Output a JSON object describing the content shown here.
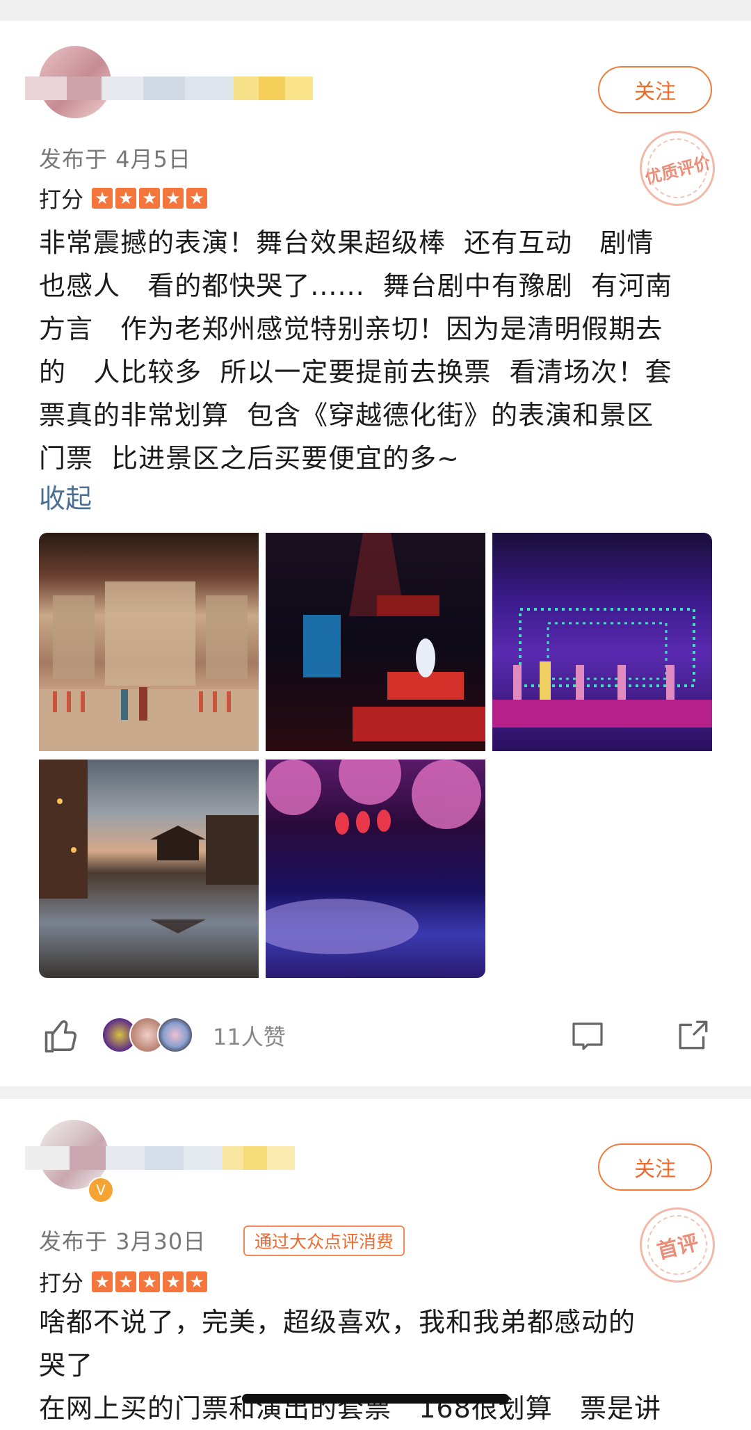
{
  "reviews": [
    {
      "follow_label": "关注",
      "stamp": "优质评价",
      "date": "发布于 4月5日",
      "score_label": "打分",
      "stars": 5,
      "text": "非常震撼的表演！舞台效果超级棒  还有互动   剧情\n也感人   看的都快哭了......  舞台剧中有豫剧  有河南\n方言   作为老郑州感觉特别亲切！因为是清明假期去\n的   人比较多  所以一定要提前去换票  看清场次！套\n票真的非常划算  包含《穿越德化街》的表演和景区\n门票  比进景区之后买要便宜的多~",
      "collapse_label": "收起",
      "photos": [
        "stage-street-scene",
        "stage-opera-red",
        "stage-purple-dance",
        "night-pavilion-reflection",
        "cherry-blossom-lanterns"
      ],
      "likes_text": "11人赞"
    },
    {
      "follow_label": "关注",
      "stamp": "首评",
      "date": "发布于 3月30日",
      "badge": "通过大众点评消费",
      "score_label": "打分",
      "stars": 5,
      "text": "啥都不说了，完美，超级喜欢，我和我弟都感动的\n哭了\n在网上买的门票和演出的套票   168很划算   票是讲"
    }
  ],
  "colors": {
    "accent": "#f06a2a",
    "star": "#f4763d",
    "link": "#4a6f93"
  }
}
